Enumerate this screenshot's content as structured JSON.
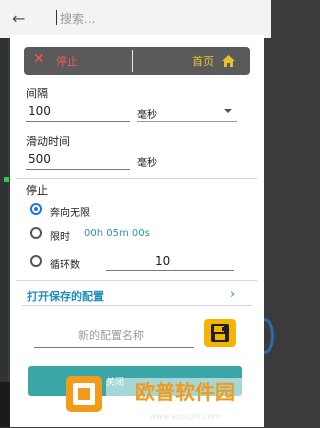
{
  "background": {
    "search_placeholder": "搜索..."
  },
  "dialog": {
    "topbar": {
      "stop_label": "停止",
      "home_label": "首页"
    },
    "interval": {
      "label": "间隔",
      "value": "100",
      "unit": "毫秒"
    },
    "swipe_time": {
      "label": "滑动时间",
      "value": "500",
      "unit": "毫秒"
    },
    "stop_section": {
      "label": "停止",
      "options": [
        {
          "label": "奔向无限",
          "selected": true
        },
        {
          "label": "限时",
          "time": "00h 05m 00s",
          "selected": false
        },
        {
          "label": "循环数",
          "value": "10",
          "selected": false
        }
      ]
    },
    "open_saved_config": "打开保存的配置",
    "new_config_placeholder": "新的配置名称",
    "close_button": "关闭"
  },
  "watermark": {
    "title": "欧普软件园",
    "url": "www.apoujin.com"
  },
  "colors": {
    "stop_red": "#e85a5a",
    "home_yellow": "#e8c12e",
    "radio_blue": "#1a73e8",
    "link_blue": "#1f8fbf",
    "save_yellow": "#f4b400",
    "close_teal": "#3aa6a6"
  }
}
